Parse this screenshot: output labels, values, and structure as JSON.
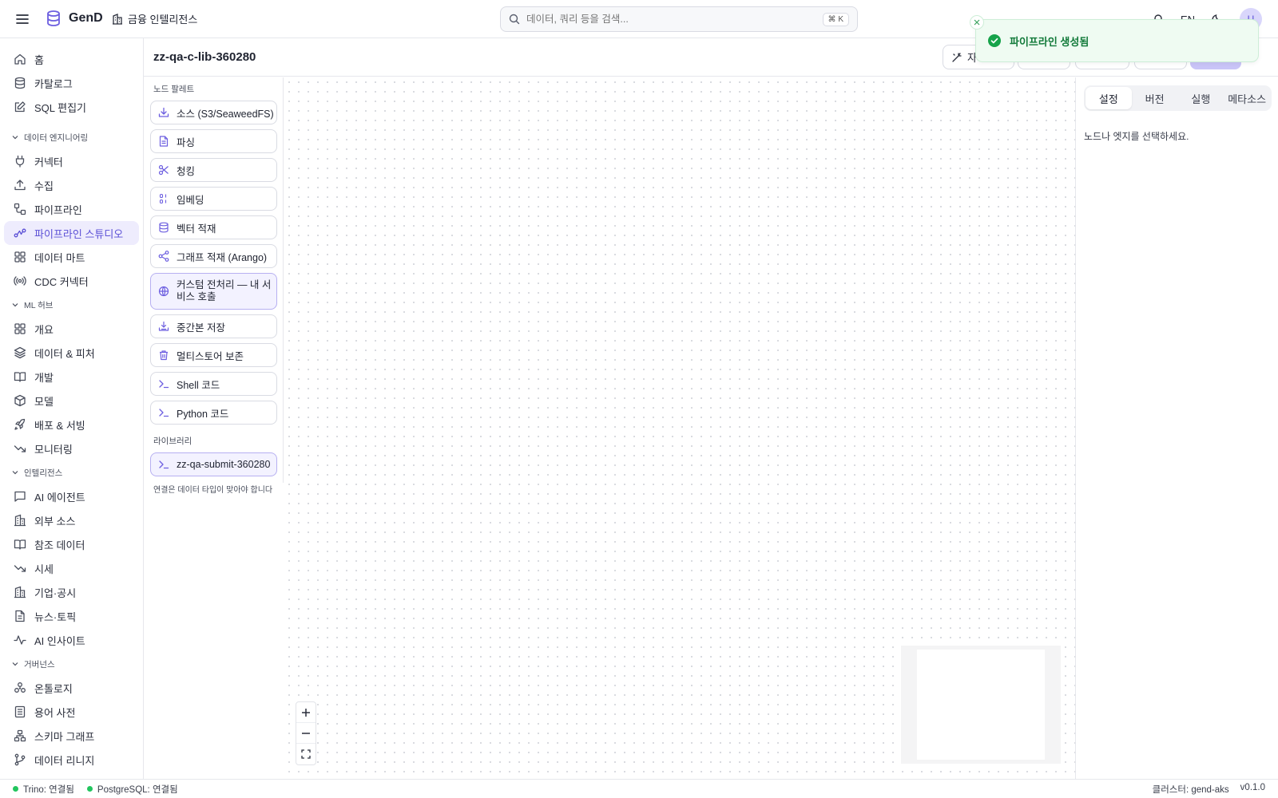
{
  "app": {
    "name": "GenD",
    "workspace": "금융 인텔리전스"
  },
  "search": {
    "placeholder": "데이터, 쿼리 등을 검색...",
    "shortcut": "⌘ K"
  },
  "topbar": {
    "lang": "EN",
    "avatar": "U"
  },
  "toast": {
    "message": "파이프라인 생성됨"
  },
  "page": {
    "title": "zz-qa-c-lib-360280",
    "buttons": [
      {
        "label": "자"
      },
      {
        "label": ""
      },
      {
        "label": ""
      },
      {
        "label": ""
      },
      {
        "label": ""
      }
    ]
  },
  "sidebar": {
    "top": [
      {
        "label": "홈",
        "icon": "home-icon"
      },
      {
        "label": "카탈로그",
        "icon": "database-icon"
      },
      {
        "label": "SQL 편집기",
        "icon": "edit-icon"
      }
    ],
    "sections": [
      {
        "title": "데이터 엔지니어링",
        "items": [
          {
            "label": "커넥터",
            "icon": "plug-icon"
          },
          {
            "label": "수집",
            "icon": "upload-icon"
          },
          {
            "label": "파이프라인",
            "icon": "workflow-icon"
          },
          {
            "label": "파이프라인 스튜디오",
            "icon": "route-icon",
            "active": true
          },
          {
            "label": "데이터 마트",
            "icon": "grid-icon"
          },
          {
            "label": "CDC 커넥터",
            "icon": "radio-icon"
          }
        ]
      },
      {
        "title": "ML 허브",
        "items": [
          {
            "label": "개요",
            "icon": "grid-icon"
          },
          {
            "label": "데이터 & 피처",
            "icon": "layers-icon"
          },
          {
            "label": "개발",
            "icon": "book-icon"
          },
          {
            "label": "모델",
            "icon": "box-icon"
          },
          {
            "label": "배포 & 서빙",
            "icon": "rocket-icon"
          },
          {
            "label": "모니터링",
            "icon": "trending-icon"
          }
        ]
      },
      {
        "title": "인텔리전스",
        "items": [
          {
            "label": "AI 에이전트",
            "icon": "chat-icon"
          },
          {
            "label": "외부 소스",
            "icon": "building-icon"
          },
          {
            "label": "참조 데이터",
            "icon": "book-icon"
          },
          {
            "label": "시세",
            "icon": "trending-icon"
          },
          {
            "label": "기업·공시",
            "icon": "building-icon"
          },
          {
            "label": "뉴스·토픽",
            "icon": "file-icon"
          },
          {
            "label": "AI 인사이트",
            "icon": "pulse-icon"
          }
        ]
      },
      {
        "title": "거버넌스",
        "items": [
          {
            "label": "온톨로지",
            "icon": "network-icon"
          },
          {
            "label": "용어 사전",
            "icon": "list-icon"
          },
          {
            "label": "스키마 그래프",
            "icon": "graph-icon"
          },
          {
            "label": "데이터 리니지",
            "icon": "branch-icon"
          }
        ]
      }
    ]
  },
  "palette": {
    "heading": "노드 팔레트",
    "items": [
      {
        "label": "소스 (S3/SeaweedFS)",
        "icon": "download-icon"
      },
      {
        "label": "파싱",
        "icon": "file-icon"
      },
      {
        "label": "청킹",
        "icon": "scissors-icon"
      },
      {
        "label": "임베딩",
        "icon": "binary-icon"
      },
      {
        "label": "벡터 적재",
        "icon": "database-icon"
      },
      {
        "label": "그래프 적재 (Arango)",
        "icon": "share-icon"
      },
      {
        "label": "커스텀 전처리 — 내 서비스 호출",
        "icon": "globe-icon"
      },
      {
        "label": "중간본 저장",
        "icon": "save-icon"
      },
      {
        "label": "멀티스토어 보존",
        "icon": "archive-icon"
      },
      {
        "label": "Shell 코드",
        "icon": "terminal-icon"
      },
      {
        "label": "Python 코드",
        "icon": "terminal-icon"
      }
    ],
    "library_heading": "라이브러리",
    "library_items": [
      {
        "label": "zz-qa-submit-360280",
        "icon": "terminal-icon"
      }
    ],
    "hint": "연결은 데이터 타입이 맞아야 합니다"
  },
  "right_panel": {
    "tabs": [
      "설정",
      "버전",
      "실행",
      "메타소스"
    ],
    "active_tab": "설정",
    "empty_message": "노드나 엣지를 선택하세요."
  },
  "status": {
    "trino": "Trino: 연결됨",
    "postgres": "PostgreSQL: 연결됨",
    "cluster": "클러스터: gend-aks",
    "version": "v0.1.0"
  }
}
